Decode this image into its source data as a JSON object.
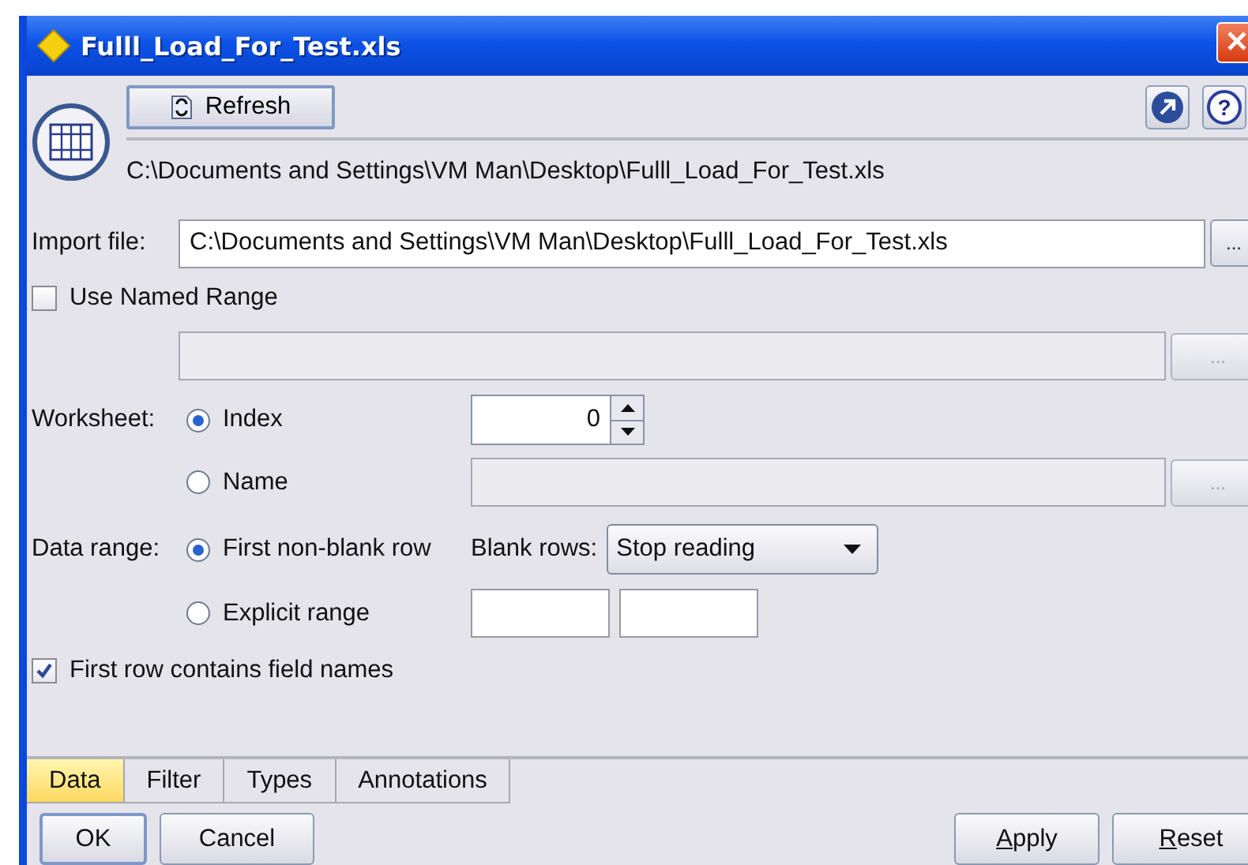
{
  "window": {
    "title": "Fulll_Load_For_Test.xls"
  },
  "toolbar": {
    "refresh": "Refresh",
    "help": "?"
  },
  "file_path": "C:\\Documents and Settings\\VM Man\\Desktop\\Fulll_Load_For_Test.xls",
  "import_file": {
    "label": "Import file:",
    "value": "C:\\Documents and Settings\\VM Man\\Desktop\\Fulll_Load_For_Test.xls",
    "browse": "..."
  },
  "use_named_range": {
    "label": "Use Named Range",
    "checked": false
  },
  "named_range": {
    "browse": "...",
    "disabled": true
  },
  "worksheet": {
    "label": "Worksheet:",
    "options": [
      {
        "label": "Index",
        "selected": true
      },
      {
        "label": "Name",
        "selected": false
      }
    ],
    "index_value": "0",
    "name_browse": "...",
    "name_disabled": true
  },
  "data_range": {
    "label": "Data range:",
    "options": [
      {
        "label": "First non-blank row",
        "selected": true
      },
      {
        "label": "Explicit range",
        "selected": false
      }
    ],
    "blank_rows_label": "Blank rows:",
    "blank_rows_value": "Stop reading"
  },
  "first_row_names": {
    "label": "First row contains field names",
    "checked": true
  },
  "tabs": [
    {
      "label": "Data",
      "selected": true
    },
    {
      "label": "Filter",
      "selected": false
    },
    {
      "label": "Types",
      "selected": false
    },
    {
      "label": "Annotations",
      "selected": false
    }
  ],
  "buttons": [
    {
      "label": "OK",
      "focused": true
    },
    {
      "label": "Cancel",
      "focused": false
    },
    {
      "label": "Apply",
      "focused": false,
      "mnemonic": true
    },
    {
      "label": "Reset",
      "focused": false,
      "mnemonic": true
    }
  ]
}
